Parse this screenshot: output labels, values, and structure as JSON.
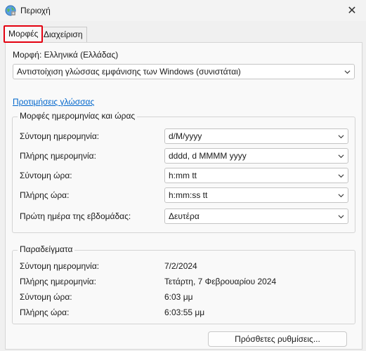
{
  "window": {
    "title": "Περιοχή",
    "close_glyph": "✕"
  },
  "tabs": [
    {
      "label": "Μορφές",
      "active": true
    },
    {
      "label": "Διαχείριση",
      "active": false
    }
  ],
  "format": {
    "label": "Μορφή: Ελληνικά (Ελλάδας)",
    "selected": "Αντιστοίχιση γλώσσας εμφάνισης των Windows (συνιστάται)"
  },
  "language_prefs_link": "Προτιμήσεις γλώσσας",
  "date_time_group": {
    "title": "Μορφές ημερομηνίας και ώρας",
    "rows": [
      {
        "label": "Σύντομη ημερομηνία:",
        "value": "d/M/yyyy"
      },
      {
        "label": "Πλήρης ημερομηνία:",
        "value": "dddd, d MMMM yyyy"
      },
      {
        "label": "Σύντομη ώρα:",
        "value": "h:mm tt"
      },
      {
        "label": "Πλήρης ώρα:",
        "value": "h:mm:ss tt"
      },
      {
        "label": "Πρώτη ημέρα της εβδομάδας:",
        "value": "Δευτέρα"
      }
    ]
  },
  "examples_group": {
    "title": "Παραδείγματα",
    "rows": [
      {
        "label": "Σύντομη ημερομηνία:",
        "value": "7/2/2024"
      },
      {
        "label": "Πλήρης ημερομηνία:",
        "value": "Τετάρτη, 7 Φεβρουαρίου 2024"
      },
      {
        "label": "Σύντομη ώρα:",
        "value": "6:03 μμ"
      },
      {
        "label": "Πλήρης ώρα:",
        "value": "6:03:55 μμ"
      }
    ]
  },
  "additional_settings_button": "Πρόσθετες ρυθμίσεις...",
  "colors": {
    "active_tab_highlight": "#e3000f",
    "link": "#0066cc"
  }
}
